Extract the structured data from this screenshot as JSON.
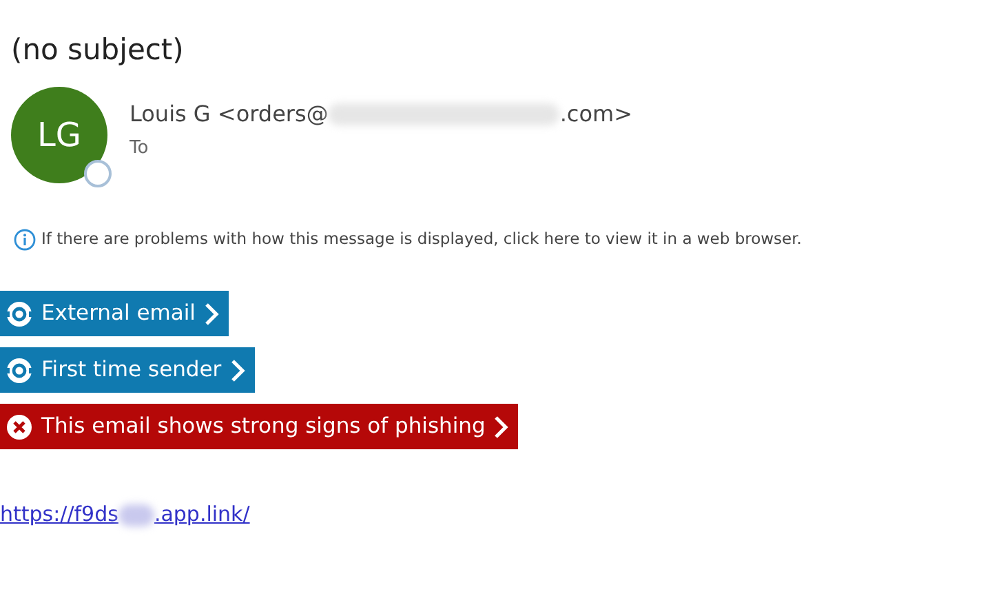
{
  "subject": "(no subject)",
  "sender": {
    "initials": "LG",
    "name_start": "Louis G <orders@",
    "name_end": ".com>",
    "to": "To"
  },
  "info": "If there are problems with how this message is displayed, click here to view it in a web browser.",
  "banners": [
    {
      "kind": "info",
      "text": "External email"
    },
    {
      "kind": "info",
      "text": "First time sender"
    },
    {
      "kind": "danger",
      "text": "This email shows strong signs of phishing"
    }
  ],
  "link": {
    "start": "https://f9ds",
    "end": ".app.link/"
  }
}
